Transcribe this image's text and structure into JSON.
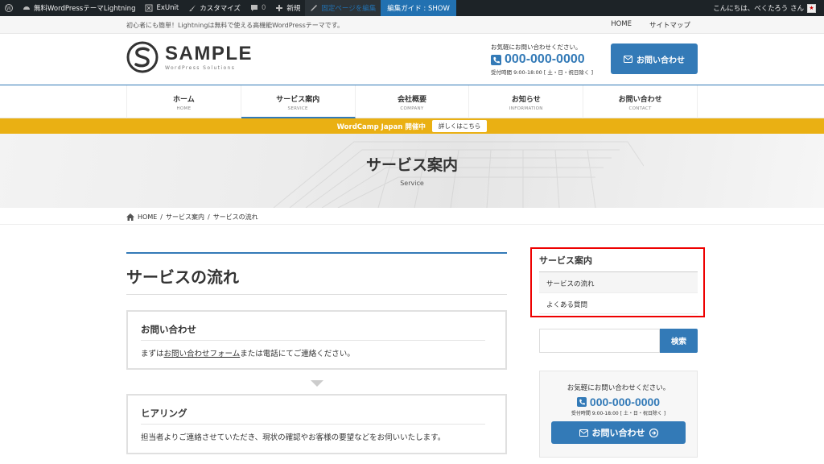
{
  "adminbar": {
    "site_name": "無料WordPressテーマLightning",
    "exunit": "ExUnit",
    "customize": "カスタマイズ",
    "comments_count": "0",
    "new": "新規",
    "edit_page": "固定ページを編集",
    "edit_guide": "編集ガイド : SHOW",
    "greeting": "こんにちは、べくたろう さん"
  },
  "topstrip": {
    "description": "初心者にも簡単！Lightningは無料で使える高機能WordPressテーマです。",
    "links": [
      "HOME",
      "サイトマップ"
    ]
  },
  "header": {
    "logo_title": "SAMPLE",
    "logo_sub": "WordPress Solutions",
    "contact_msg": "お気軽にお問い合わせください。",
    "tel": "000-000-0000",
    "hours": "受付時間 9:00-18:00 [ 土・日・祝日除く ]",
    "button_label": "お問い合わせ"
  },
  "nav": {
    "items": [
      {
        "ja": "ホーム",
        "en": "HOME"
      },
      {
        "ja": "サービス案内",
        "en": "SERVICE"
      },
      {
        "ja": "会社概要",
        "en": "COMPANY"
      },
      {
        "ja": "お知らせ",
        "en": "INFORMATION"
      },
      {
        "ja": "お問い合わせ",
        "en": "CONTACT"
      }
    ],
    "active_index": 1
  },
  "notice": {
    "text": "WordCamp Japan 開催中",
    "button": "詳しくはこちら"
  },
  "page_header": {
    "title": "サービス案内",
    "subtitle": "Service"
  },
  "breadcrumb": [
    "HOME",
    "サービス案内",
    "サービスの流れ"
  ],
  "main": {
    "title": "サービスの流れ",
    "cards": [
      {
        "title": "お問い合わせ",
        "text_before": "まずは",
        "link": "お問い合わせフォーム",
        "text_after": "または電話にてご連絡ください。"
      },
      {
        "title": "ヒアリング",
        "text": "担当者よりご連絡させていただき、現状の確認やお客様の要望などをお伺いいたします。"
      }
    ]
  },
  "sidebar": {
    "title": "サービス案内",
    "items": [
      "サービスの流れ",
      "よくある質問"
    ],
    "search_button": "検索",
    "contact_msg": "お気軽にお問い合わせください。",
    "tel": "000-000-0000",
    "hours": "受付時間 9:00-18:00 [ 土・日・祝日除く ]",
    "contact_button": "お問い合わせ"
  },
  "colors": {
    "accent": "#337ab7",
    "notice": "#eab013",
    "admin_bar": "#1d2327",
    "highlight_box": "#ee0000"
  }
}
